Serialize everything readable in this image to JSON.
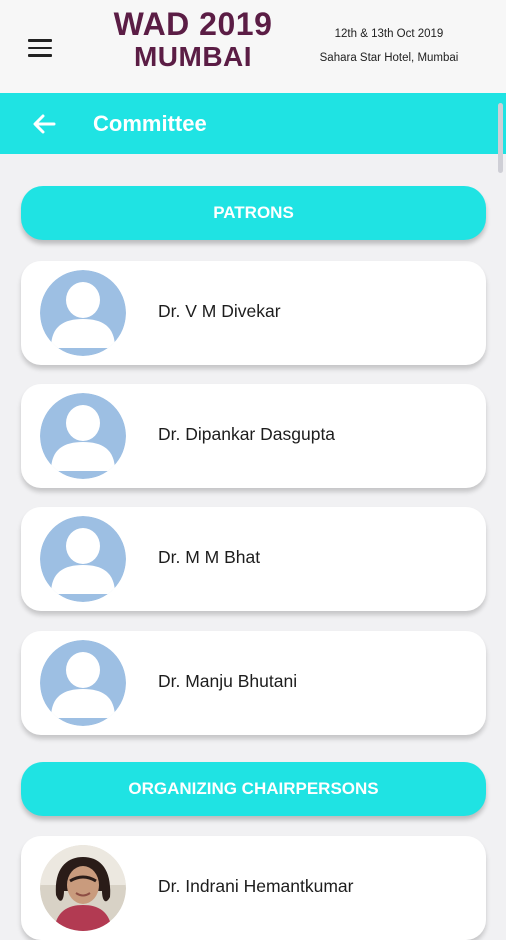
{
  "header": {
    "event_line1": "WAD 2019",
    "event_line2": "MUMBAI",
    "date": "12th & 13th Oct 2019",
    "venue": "Sahara Star Hotel, Mumbai",
    "menu_icon": "hamburger-menu-icon"
  },
  "title_bar": {
    "title": "Committee",
    "back_icon": "back-arrow-icon"
  },
  "sections": [
    {
      "title": "PATRONS",
      "members": [
        {
          "name": "Dr. V M Divekar",
          "avatar": "placeholder"
        },
        {
          "name": "Dr. Dipankar Dasgupta",
          "avatar": "placeholder"
        },
        {
          "name": "Dr. M M Bhat",
          "avatar": "placeholder"
        },
        {
          "name": "Dr. Manju Bhutani",
          "avatar": "placeholder"
        }
      ]
    },
    {
      "title": "ORGANIZING CHAIRPERSONS",
      "members": [
        {
          "name": "Dr. Indrani Hemantkumar",
          "avatar": "photo"
        }
      ]
    }
  ],
  "colors": {
    "accent": "#1fe3e3",
    "brand": "#5b1d45",
    "avatar_placeholder": "#9dbfe3"
  }
}
